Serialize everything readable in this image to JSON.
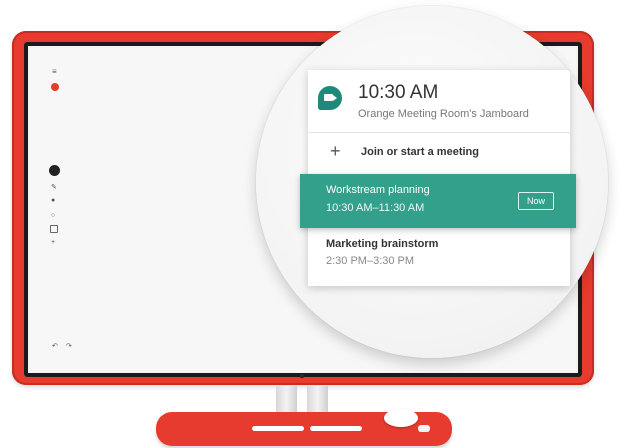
{
  "header": {
    "time": "10:30 AM",
    "room": "Orange Meeting Room's Jamboard"
  },
  "join": {
    "label": "Join or start a meeting"
  },
  "events": [
    {
      "title": "Workstream planning",
      "time": "10:30 AM–11:30 AM",
      "badge": "Now"
    },
    {
      "title": "Marketing brainstorm",
      "time": "2:30 PM–3:30 PM"
    }
  ],
  "colors": {
    "device_red": "#e63b2e",
    "meet_green": "#1f8a79",
    "active_event": "#32a08b"
  },
  "icons": {
    "meet": "meet-icon",
    "join": "plus-icon",
    "menu": "menu-icon",
    "pen": "pen-icon",
    "undo": "undo-icon",
    "redo": "redo-icon"
  }
}
